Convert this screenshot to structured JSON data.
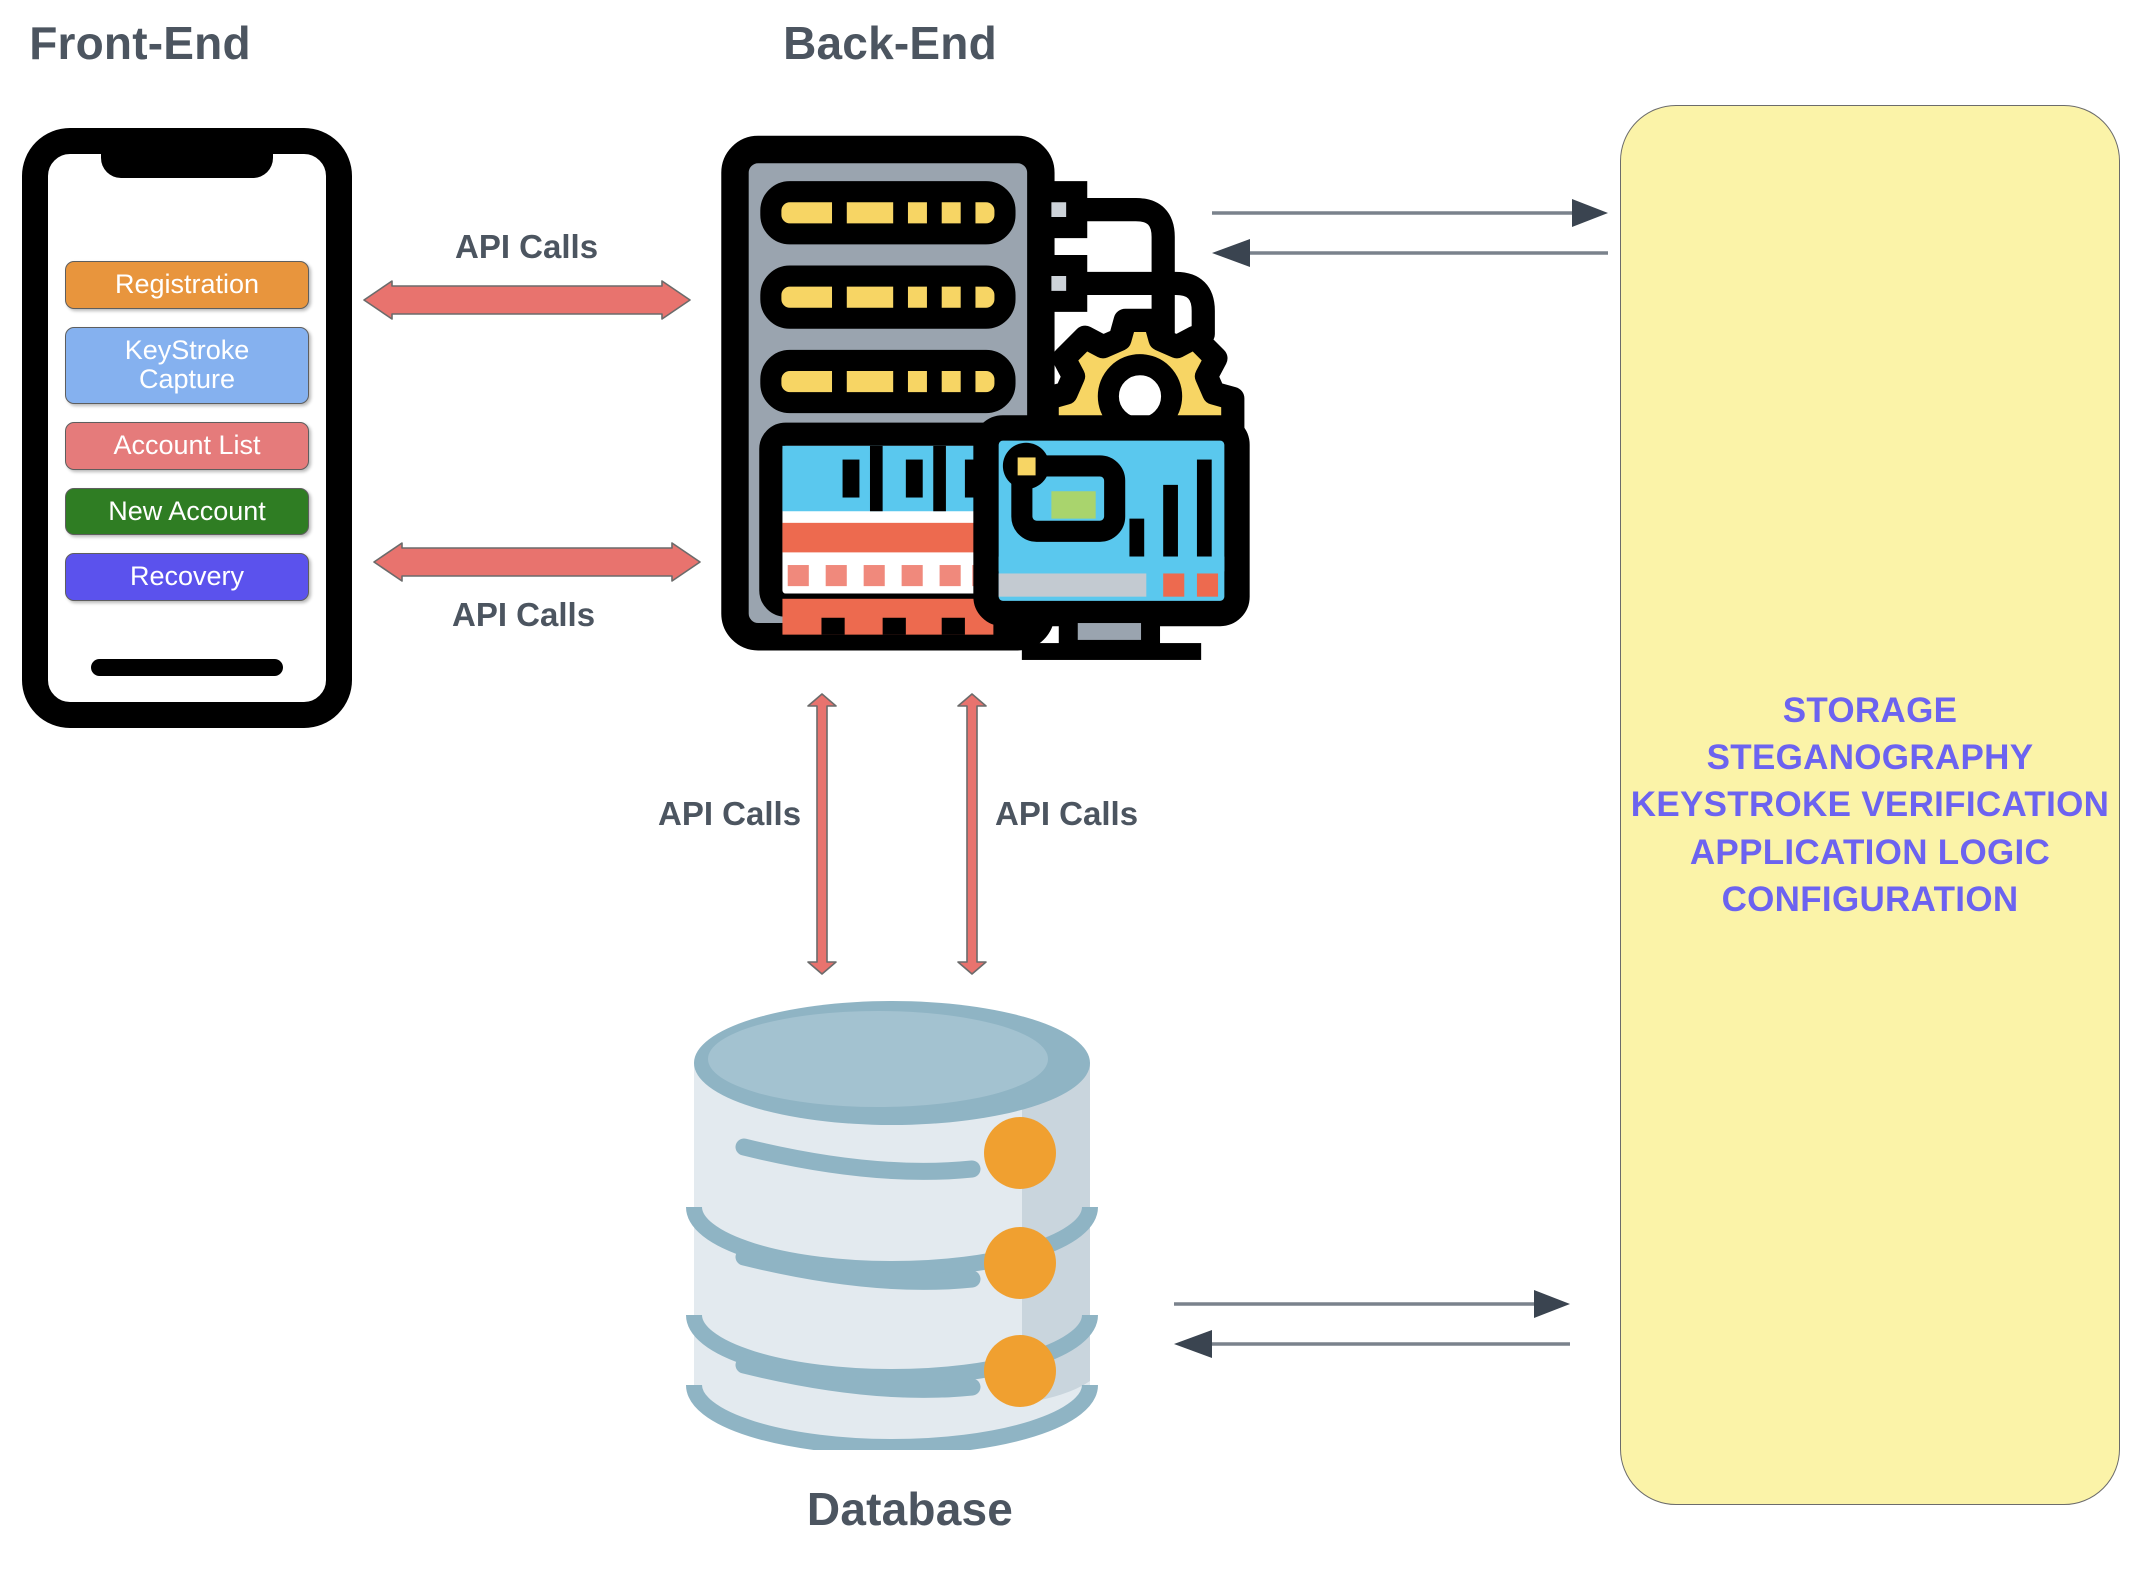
{
  "diagram": {
    "title_front_end": "Front-End",
    "title_back_end": "Back-End",
    "title_database": "Database"
  },
  "front_end": {
    "device": "smartphone",
    "buttons": [
      {
        "label": "Registration",
        "color": "#e8953d",
        "name": "registration"
      },
      {
        "label": "KeyStroke\nCapture",
        "color": "#85b1ef",
        "name": "keystroke-capture"
      },
      {
        "label": "Account List",
        "color": "#e57b7b",
        "name": "account-list"
      },
      {
        "label": "New Account",
        "color": "#2f7d23",
        "name": "new-account"
      },
      {
        "label": "Recovery",
        "color": "#5b52ed",
        "name": "recovery"
      }
    ]
  },
  "back_end": {
    "icon_name": "server-rack-with-monitor-and-gear-icon"
  },
  "database": {
    "icon_name": "database-cylinder-icon"
  },
  "connectors": {
    "api_label": "API Calls",
    "arrow_color": "#e8736e",
    "thin_arrow_color": "#3a4450",
    "items": [
      {
        "name": "front-end-to-back-end-top",
        "label": "API Calls",
        "orientation": "horizontal",
        "label_position": "above"
      },
      {
        "name": "front-end-to-back-end-bottom",
        "label": "API Calls",
        "orientation": "horizontal",
        "label_position": "below"
      },
      {
        "name": "back-end-to-database-left",
        "label": "API Calls",
        "orientation": "vertical",
        "label_position": "left"
      },
      {
        "name": "back-end-to-database-right",
        "label": "API Calls",
        "orientation": "vertical",
        "label_position": "right"
      }
    ]
  },
  "services_panel": {
    "background_color": "#fbf3a8",
    "text_color": "#6c63f0",
    "items": [
      "STORAGE",
      "STEGANOGRAPHY",
      "KEYSTROKE VERIFICATION",
      "APPLICATION LOGIC",
      "CONFIGURATION"
    ]
  }
}
